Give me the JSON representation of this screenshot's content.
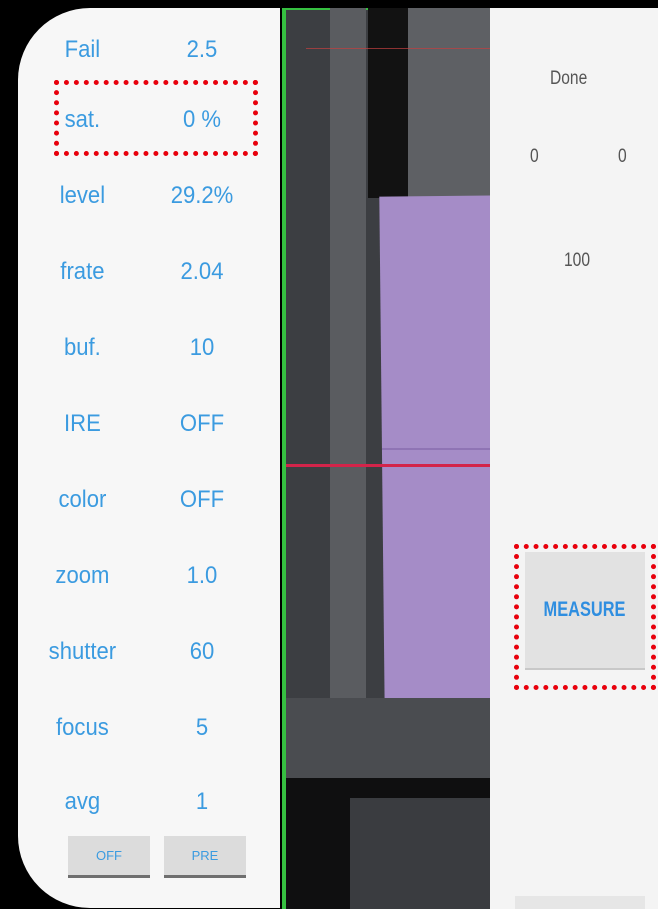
{
  "settings": {
    "params": [
      {
        "label": "Fail",
        "value": "2.5"
      },
      {
        "label": "sat.",
        "value": "0 %"
      },
      {
        "label": "level",
        "value": "29.2%"
      },
      {
        "label": "frate",
        "value": "2.04"
      },
      {
        "label": "buf.",
        "value": "10"
      },
      {
        "label": "IRE",
        "value": "OFF"
      },
      {
        "label": "color",
        "value": "OFF"
      },
      {
        "label": "zoom",
        "value": "1.0"
      },
      {
        "label": "shutter",
        "value": "60"
      },
      {
        "label": "focus",
        "value": "5"
      },
      {
        "label": "avg",
        "value": "1"
      }
    ],
    "buttons": {
      "off_label": "OFF",
      "pre_label": "PRE"
    }
  },
  "results": {
    "status": "Done",
    "value_left": "0",
    "value_right": "0",
    "value_center": "100",
    "measure_label": "MEASURE"
  },
  "colors": {
    "accent_text": "#3b9be0",
    "highlight": "#e8000c",
    "preview_border": "#36c041",
    "crosshair": "#d3244a"
  }
}
